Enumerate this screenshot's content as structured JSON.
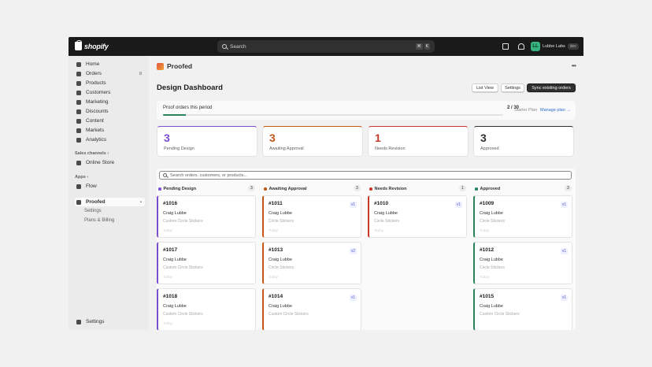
{
  "topbar": {
    "logo_text": "shopify",
    "search_placeholder": "Search",
    "shortcut_keys": [
      "⌘",
      "K"
    ],
    "store_initials": "LL",
    "store_name": "Lubbe Labs",
    "env_tag": "dev"
  },
  "sidebar": {
    "items": [
      {
        "label": "Home",
        "icon": "home-icon"
      },
      {
        "label": "Orders",
        "icon": "orders-icon",
        "count": "8"
      },
      {
        "label": "Products",
        "icon": "tag-icon"
      },
      {
        "label": "Customers",
        "icon": "person-icon"
      },
      {
        "label": "Marketing",
        "icon": "target-icon"
      },
      {
        "label": "Discounts",
        "icon": "discount-icon"
      },
      {
        "label": "Content",
        "icon": "content-icon"
      },
      {
        "label": "Markets",
        "icon": "globe-icon"
      },
      {
        "label": "Analytics",
        "icon": "chart-icon"
      }
    ],
    "sales_channels_label": "Sales channels",
    "online_store_label": "Online Store",
    "apps_label": "Apps",
    "flow_label": "Flow",
    "app_label": "Proofed",
    "app_sub_settings": "Settings",
    "app_sub_plans": "Plans & Billing",
    "settings_label": "Settings"
  },
  "app": {
    "name": "Proofed",
    "page_title": "Design Dashboard",
    "buttons": {
      "list_view": "List View",
      "settings": "Settings",
      "sync": "Sync existing orders"
    }
  },
  "plan": {
    "label": "Proof orders this period",
    "count": "2 / 30",
    "progress_fraction": 0.067,
    "plan_name": "Starter Plan",
    "manage_link": "Manage plan →"
  },
  "stats": [
    {
      "value": "3",
      "label": "Pending Design",
      "color": "#7c4dcf"
    },
    {
      "value": "3",
      "label": "Awaiting Approval",
      "color": "#c05717"
    },
    {
      "value": "1",
      "label": "Needs Revision",
      "color": "#c7382a"
    },
    {
      "value": "3",
      "label": "Approved",
      "color": "#303030"
    }
  ],
  "board": {
    "search_placeholder": "Search orders, customers, or products...",
    "columns": [
      {
        "title": "Pending Design",
        "count": "3",
        "color": "#7c4dcf",
        "cards": [
          {
            "id": "#1016",
            "customer": "Craig Lubbe",
            "product": "Custom Circle Stickers",
            "date": "Today",
            "version": ""
          },
          {
            "id": "#1017",
            "customer": "Craig Lubbe",
            "product": "Custom Circle Stickers",
            "date": "Today",
            "version": ""
          },
          {
            "id": "#1018",
            "customer": "Craig Lubbe",
            "product": "Custom Circle Stickers",
            "date": "Today",
            "version": ""
          }
        ]
      },
      {
        "title": "Awaiting Approval",
        "count": "3",
        "color": "#c05717",
        "cards": [
          {
            "id": "#1011",
            "customer": "Craig Lubbe",
            "product": "Circle Stickers",
            "date": "Today",
            "version": "v1"
          },
          {
            "id": "#1013",
            "customer": "Craig Lubbe",
            "product": "Circle Stickers",
            "date": "Today",
            "version": "v2"
          },
          {
            "id": "#1014",
            "customer": "Craig Lubbe",
            "product": "Custom Circle Stickers",
            "date": "",
            "version": "v1"
          }
        ]
      },
      {
        "title": "Needs Revision",
        "count": "1",
        "color": "#c7382a",
        "cards": [
          {
            "id": "#1010",
            "customer": "Craig Lubbe",
            "product": "Circle Stickers",
            "date": "Today",
            "version": "v1"
          }
        ]
      },
      {
        "title": "Approved",
        "count": "3",
        "color": "#29845a",
        "cards": [
          {
            "id": "#1009",
            "customer": "Craig Lubbe",
            "product": "Circle Stickers",
            "date": "Today",
            "version": "v1"
          },
          {
            "id": "#1012",
            "customer": "Craig Lubbe",
            "product": "Circle Stickers",
            "date": "Today",
            "version": "v1"
          },
          {
            "id": "#1015",
            "customer": "Craig Lubbe",
            "product": "Custom Circle Stickers",
            "date": "",
            "version": "v1"
          }
        ]
      }
    ]
  }
}
